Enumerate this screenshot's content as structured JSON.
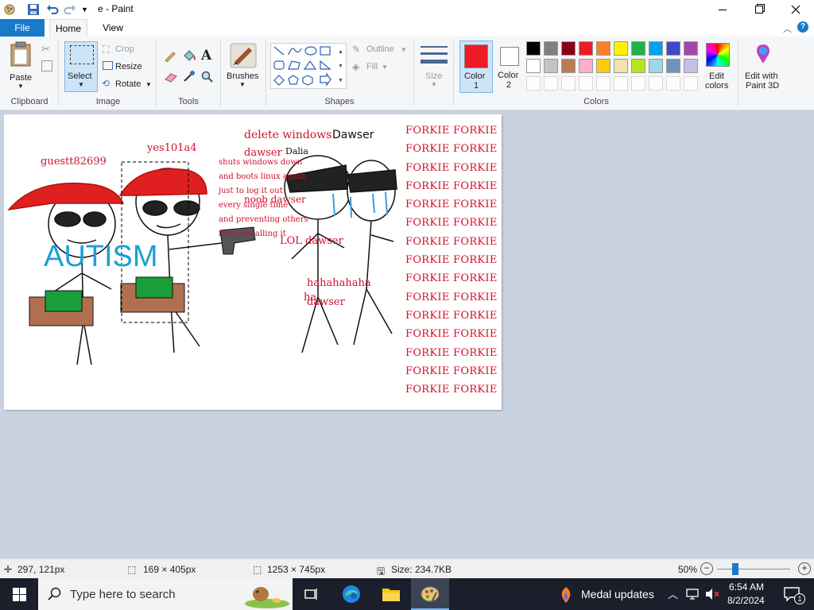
{
  "window": {
    "title": "e - Paint",
    "minimize_icon": "minimize-icon",
    "maximize_icon": "restore-icon",
    "close_icon": "close-icon"
  },
  "tabs": {
    "file": "File",
    "home": "Home",
    "view": "View"
  },
  "clipboard": {
    "paste": "Paste",
    "label": "Clipboard"
  },
  "image": {
    "select": "Select",
    "crop": "Crop",
    "resize": "Resize",
    "rotate": "Rotate",
    "label": "Image"
  },
  "tools": {
    "label": "Tools"
  },
  "brushes": {
    "label": "Brushes"
  },
  "shapes": {
    "outline": "Outline",
    "fill": "Fill",
    "label": "Shapes"
  },
  "size": {
    "label": "Size"
  },
  "colors": {
    "color1_label": "Color",
    "color1_num": "1",
    "color2_label": "Color",
    "color2_num": "2",
    "color1_value": "#ed1c24",
    "color2_value": "#ffffff",
    "edit_colors_line1": "Edit",
    "edit_colors_line2": "colors",
    "edit3d_line1": "Edit with",
    "edit3d_line2": "Paint 3D",
    "label": "Colors",
    "palette_row1": [
      "#000000",
      "#7f7f7f",
      "#880015",
      "#ed1c24",
      "#ff7f27",
      "#fff200",
      "#22b14c",
      "#00a2e8",
      "#3f48cc",
      "#a349a4"
    ],
    "palette_row2": [
      "#ffffff",
      "#c3c3c3",
      "#b97a57",
      "#ffaec9",
      "#ffc90e",
      "#efe4b0",
      "#b5e61d",
      "#99d9ea",
      "#7092be",
      "#c8bfe7"
    ]
  },
  "drawing": {
    "names": {
      "guest": "guestt82699",
      "yes": "yes101a4",
      "delete": "delete windows",
      "dawser_top": "Dawser",
      "dawser_mid": "dawser",
      "dalia": "Dalia",
      "autism": "AUTISM",
      "lol": "LOL dawser",
      "noob": "noob dawser",
      "haha": "hahahahaha",
      "ha": "ha",
      "dawser_low": "dawser"
    },
    "story_lines": [
      "shuts windows down",
      "and boots linux again",
      "just to log it out",
      "every single time",
      "and preventing others",
      "from installing it"
    ],
    "forkie": [
      "FORKIE FORKIE",
      "FORKIE FORKIE",
      "FORKIE FORKIE",
      "FORKIE FORKIE",
      "FORKIE FORKIE",
      "FORKIE FORKIE",
      "FORKIE FORKIE",
      "FORKIE FORKIE",
      "FORKIE FORKIE",
      "FORKIE FORKIE",
      "FORKIE FORKIE",
      "FORKIE FORKIE",
      "FORKIE FORKIE",
      "FORKIE FORKIE",
      "FORKIE FORKIE"
    ]
  },
  "status": {
    "cursor_pos": "297, 121px",
    "selection_size": "169 × 405px",
    "image_size": "1253 × 745px",
    "file_size": "Size: 234.7KB",
    "zoom": "50%",
    "zoom_fraction": 0.5
  },
  "taskbar": {
    "search_placeholder": "Type here to search",
    "medal_updates": "Medal updates",
    "time": "6:54 AM",
    "date": "8/2/2024",
    "notification_count": "1"
  }
}
